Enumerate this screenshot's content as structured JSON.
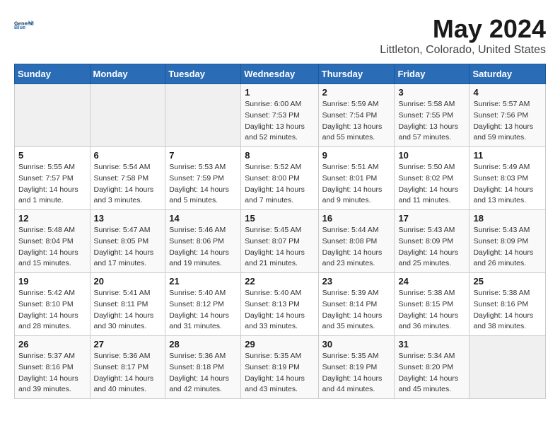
{
  "header": {
    "logo_general": "General",
    "logo_blue": "Blue",
    "title": "May 2024",
    "subtitle": "Littleton, Colorado, United States"
  },
  "days_of_week": [
    "Sunday",
    "Monday",
    "Tuesday",
    "Wednesday",
    "Thursday",
    "Friday",
    "Saturday"
  ],
  "weeks": [
    [
      {
        "day": "",
        "sunrise": "",
        "sunset": "",
        "daylight": ""
      },
      {
        "day": "",
        "sunrise": "",
        "sunset": "",
        "daylight": ""
      },
      {
        "day": "",
        "sunrise": "",
        "sunset": "",
        "daylight": ""
      },
      {
        "day": "1",
        "sunrise": "Sunrise: 6:00 AM",
        "sunset": "Sunset: 7:53 PM",
        "daylight": "Daylight: 13 hours and 52 minutes."
      },
      {
        "day": "2",
        "sunrise": "Sunrise: 5:59 AM",
        "sunset": "Sunset: 7:54 PM",
        "daylight": "Daylight: 13 hours and 55 minutes."
      },
      {
        "day": "3",
        "sunrise": "Sunrise: 5:58 AM",
        "sunset": "Sunset: 7:55 PM",
        "daylight": "Daylight: 13 hours and 57 minutes."
      },
      {
        "day": "4",
        "sunrise": "Sunrise: 5:57 AM",
        "sunset": "Sunset: 7:56 PM",
        "daylight": "Daylight: 13 hours and 59 minutes."
      }
    ],
    [
      {
        "day": "5",
        "sunrise": "Sunrise: 5:55 AM",
        "sunset": "Sunset: 7:57 PM",
        "daylight": "Daylight: 14 hours and 1 minute."
      },
      {
        "day": "6",
        "sunrise": "Sunrise: 5:54 AM",
        "sunset": "Sunset: 7:58 PM",
        "daylight": "Daylight: 14 hours and 3 minutes."
      },
      {
        "day": "7",
        "sunrise": "Sunrise: 5:53 AM",
        "sunset": "Sunset: 7:59 PM",
        "daylight": "Daylight: 14 hours and 5 minutes."
      },
      {
        "day": "8",
        "sunrise": "Sunrise: 5:52 AM",
        "sunset": "Sunset: 8:00 PM",
        "daylight": "Daylight: 14 hours and 7 minutes."
      },
      {
        "day": "9",
        "sunrise": "Sunrise: 5:51 AM",
        "sunset": "Sunset: 8:01 PM",
        "daylight": "Daylight: 14 hours and 9 minutes."
      },
      {
        "day": "10",
        "sunrise": "Sunrise: 5:50 AM",
        "sunset": "Sunset: 8:02 PM",
        "daylight": "Daylight: 14 hours and 11 minutes."
      },
      {
        "day": "11",
        "sunrise": "Sunrise: 5:49 AM",
        "sunset": "Sunset: 8:03 PM",
        "daylight": "Daylight: 14 hours and 13 minutes."
      }
    ],
    [
      {
        "day": "12",
        "sunrise": "Sunrise: 5:48 AM",
        "sunset": "Sunset: 8:04 PM",
        "daylight": "Daylight: 14 hours and 15 minutes."
      },
      {
        "day": "13",
        "sunrise": "Sunrise: 5:47 AM",
        "sunset": "Sunset: 8:05 PM",
        "daylight": "Daylight: 14 hours and 17 minutes."
      },
      {
        "day": "14",
        "sunrise": "Sunrise: 5:46 AM",
        "sunset": "Sunset: 8:06 PM",
        "daylight": "Daylight: 14 hours and 19 minutes."
      },
      {
        "day": "15",
        "sunrise": "Sunrise: 5:45 AM",
        "sunset": "Sunset: 8:07 PM",
        "daylight": "Daylight: 14 hours and 21 minutes."
      },
      {
        "day": "16",
        "sunrise": "Sunrise: 5:44 AM",
        "sunset": "Sunset: 8:08 PM",
        "daylight": "Daylight: 14 hours and 23 minutes."
      },
      {
        "day": "17",
        "sunrise": "Sunrise: 5:43 AM",
        "sunset": "Sunset: 8:09 PM",
        "daylight": "Daylight: 14 hours and 25 minutes."
      },
      {
        "day": "18",
        "sunrise": "Sunrise: 5:43 AM",
        "sunset": "Sunset: 8:09 PM",
        "daylight": "Daylight: 14 hours and 26 minutes."
      }
    ],
    [
      {
        "day": "19",
        "sunrise": "Sunrise: 5:42 AM",
        "sunset": "Sunset: 8:10 PM",
        "daylight": "Daylight: 14 hours and 28 minutes."
      },
      {
        "day": "20",
        "sunrise": "Sunrise: 5:41 AM",
        "sunset": "Sunset: 8:11 PM",
        "daylight": "Daylight: 14 hours and 30 minutes."
      },
      {
        "day": "21",
        "sunrise": "Sunrise: 5:40 AM",
        "sunset": "Sunset: 8:12 PM",
        "daylight": "Daylight: 14 hours and 31 minutes."
      },
      {
        "day": "22",
        "sunrise": "Sunrise: 5:40 AM",
        "sunset": "Sunset: 8:13 PM",
        "daylight": "Daylight: 14 hours and 33 minutes."
      },
      {
        "day": "23",
        "sunrise": "Sunrise: 5:39 AM",
        "sunset": "Sunset: 8:14 PM",
        "daylight": "Daylight: 14 hours and 35 minutes."
      },
      {
        "day": "24",
        "sunrise": "Sunrise: 5:38 AM",
        "sunset": "Sunset: 8:15 PM",
        "daylight": "Daylight: 14 hours and 36 minutes."
      },
      {
        "day": "25",
        "sunrise": "Sunrise: 5:38 AM",
        "sunset": "Sunset: 8:16 PM",
        "daylight": "Daylight: 14 hours and 38 minutes."
      }
    ],
    [
      {
        "day": "26",
        "sunrise": "Sunrise: 5:37 AM",
        "sunset": "Sunset: 8:16 PM",
        "daylight": "Daylight: 14 hours and 39 minutes."
      },
      {
        "day": "27",
        "sunrise": "Sunrise: 5:36 AM",
        "sunset": "Sunset: 8:17 PM",
        "daylight": "Daylight: 14 hours and 40 minutes."
      },
      {
        "day": "28",
        "sunrise": "Sunrise: 5:36 AM",
        "sunset": "Sunset: 8:18 PM",
        "daylight": "Daylight: 14 hours and 42 minutes."
      },
      {
        "day": "29",
        "sunrise": "Sunrise: 5:35 AM",
        "sunset": "Sunset: 8:19 PM",
        "daylight": "Daylight: 14 hours and 43 minutes."
      },
      {
        "day": "30",
        "sunrise": "Sunrise: 5:35 AM",
        "sunset": "Sunset: 8:19 PM",
        "daylight": "Daylight: 14 hours and 44 minutes."
      },
      {
        "day": "31",
        "sunrise": "Sunrise: 5:34 AM",
        "sunset": "Sunset: 8:20 PM",
        "daylight": "Daylight: 14 hours and 45 minutes."
      },
      {
        "day": "",
        "sunrise": "",
        "sunset": "",
        "daylight": ""
      }
    ]
  ]
}
